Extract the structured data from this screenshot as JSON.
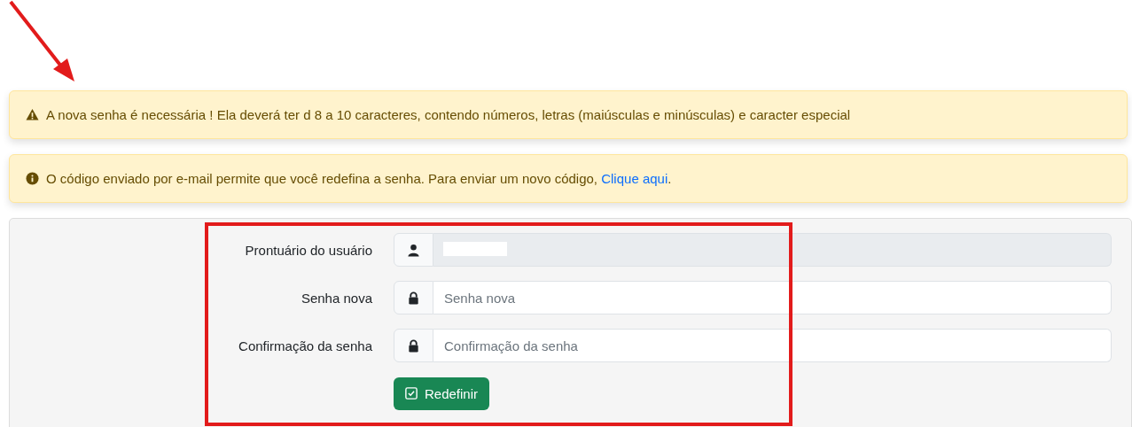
{
  "alerts": [
    {
      "kind": "warning",
      "text": "A nova senha é necessária ! Ela deverá ter d 8 a 10 caracteres, contendo números, letras (maiúsculas e minúsculas) e caracter especial"
    },
    {
      "kind": "info",
      "text": "O código enviado por e-mail permite que você redefina a senha. Para enviar um novo código,",
      "link": "Clique aqui",
      "after": "."
    }
  ],
  "form": {
    "fields": [
      {
        "label": "Prontuário do usuário",
        "kind": "user",
        "disabled": true,
        "redacted": true
      },
      {
        "label": "Senha nova",
        "kind": "password",
        "placeholder": "Senha nova",
        "disabled": false,
        "redacted": false
      },
      {
        "label": "Confirmação da senha",
        "kind": "password",
        "placeholder": "Confirmação da senha",
        "disabled": false,
        "redacted": false
      }
    ],
    "submit": {
      "label": "Redefinir"
    }
  }
}
